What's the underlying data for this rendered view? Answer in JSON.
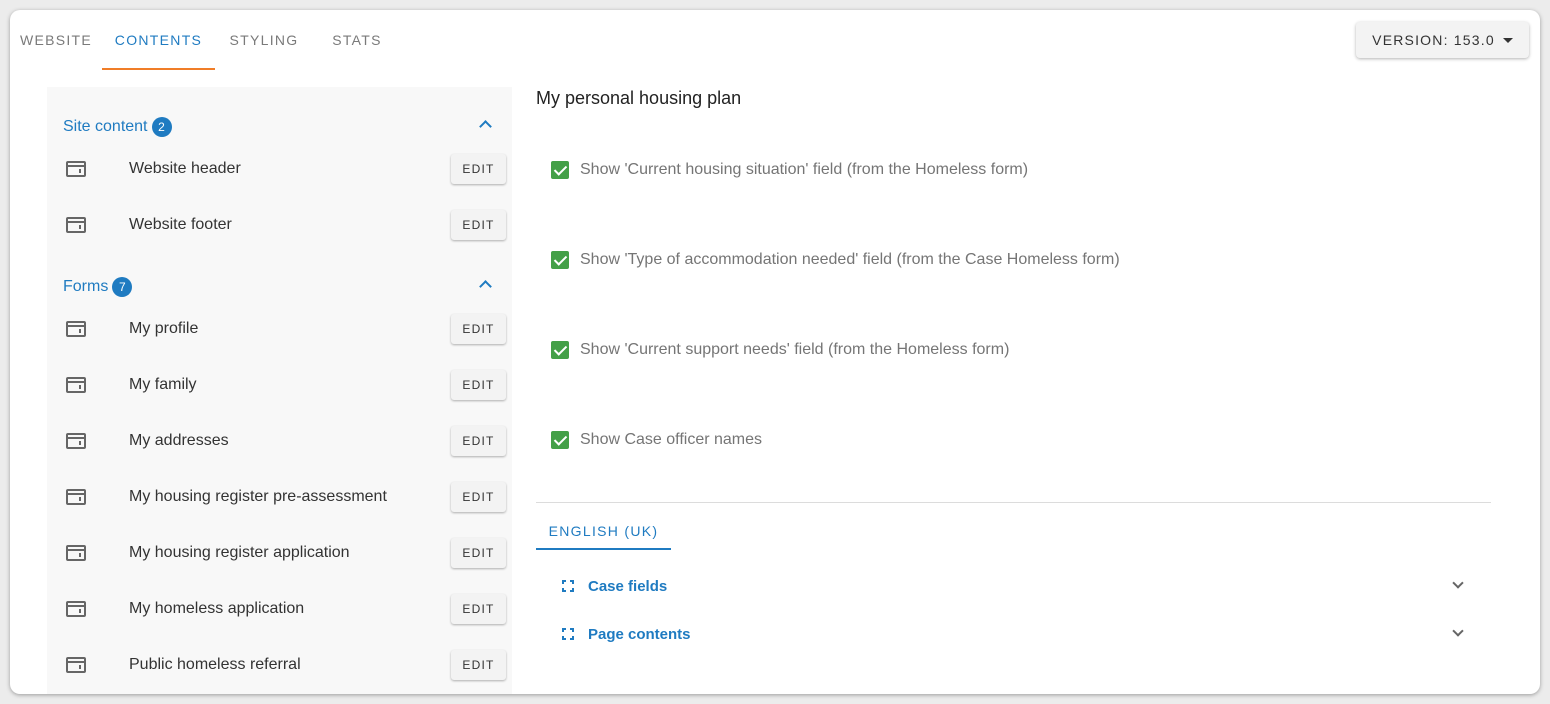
{
  "tabs": [
    {
      "label": "WEBSITE",
      "active": false
    },
    {
      "label": "CONTENTS",
      "active": true
    },
    {
      "label": "STYLING",
      "active": false
    },
    {
      "label": "STATS",
      "active": false
    }
  ],
  "version": {
    "label": "VERSION: 153.0"
  },
  "sidebar": {
    "site_content": {
      "title": "Site content",
      "count": "2",
      "items": [
        {
          "label": "Website header",
          "action": "EDIT"
        },
        {
          "label": "Website footer",
          "action": "EDIT"
        }
      ]
    },
    "forms": {
      "title": "Forms",
      "count": "7",
      "items": [
        {
          "label": "My profile",
          "action": "EDIT"
        },
        {
          "label": "My family",
          "action": "EDIT"
        },
        {
          "label": "My addresses",
          "action": "EDIT"
        },
        {
          "label": "My housing register pre-assessment",
          "action": "EDIT"
        },
        {
          "label": "My housing register application",
          "action": "EDIT"
        },
        {
          "label": "My homeless application",
          "action": "EDIT"
        },
        {
          "label": "Public homeless referral",
          "action": "EDIT"
        }
      ]
    }
  },
  "main": {
    "title": "My personal housing plan",
    "checkboxes": [
      {
        "label": "Show 'Current housing situation' field (from the Homeless form)",
        "checked": true
      },
      {
        "label": "Show 'Type of accommodation needed' field (from the Case Homeless form)",
        "checked": true
      },
      {
        "label": "Show 'Current support needs' field (from the Homeless form)",
        "checked": true
      },
      {
        "label": "Show Case officer names",
        "checked": true
      }
    ],
    "language_tab": "ENGLISH (UK)",
    "accordions": [
      {
        "label": "Case fields"
      },
      {
        "label": "Page contents"
      }
    ]
  },
  "colors": {
    "accent": "#1f7bc1",
    "tab_indicator": "#f07d28",
    "checkbox": "#43a047"
  }
}
